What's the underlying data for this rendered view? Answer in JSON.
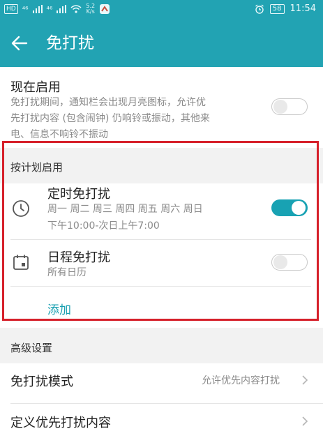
{
  "status": {
    "hd": "HD",
    "signal1": "⁴⁶",
    "signal2": "⁴⁶",
    "speed_value": "5.2",
    "speed_unit": "K/s",
    "battery": "58",
    "time": "11:54"
  },
  "header": {
    "title": "免打扰"
  },
  "now_enable": {
    "title": "现在启用",
    "desc_lines": [
      "免打扰期间，通知栏会出现月亮图标，允许优",
      "先打扰内容 (包含闹钟) 仍响铃或振动，其他来",
      "电、信息不响铃不振动"
    ],
    "enabled": false
  },
  "schedule": {
    "section_label": "按计划启用",
    "timed": {
      "title": "定时免打扰",
      "days": "周一 周二 周三 周四 周五 周六 周日",
      "time_range": "下午10:00-次日上午7:00",
      "enabled": true
    },
    "calendar": {
      "title": "日程免打扰",
      "subtitle": "所有日历",
      "enabled": false
    },
    "add_label": "添加"
  },
  "advanced": {
    "section_label": "高级设置",
    "mode": {
      "title": "免打扰模式",
      "value": "允许优先内容打扰"
    },
    "priority": {
      "title": "定义优先打扰内容"
    }
  },
  "colors": {
    "accent": "#22a3b3",
    "toggle_on": "#18a2b3",
    "highlight": "#d6202a",
    "link": "#19a0b1"
  },
  "icons": {
    "back": "arrow-left-icon",
    "clock": "clock-icon",
    "calendar": "calendar-icon",
    "chevron": "chevron-right-icon"
  }
}
